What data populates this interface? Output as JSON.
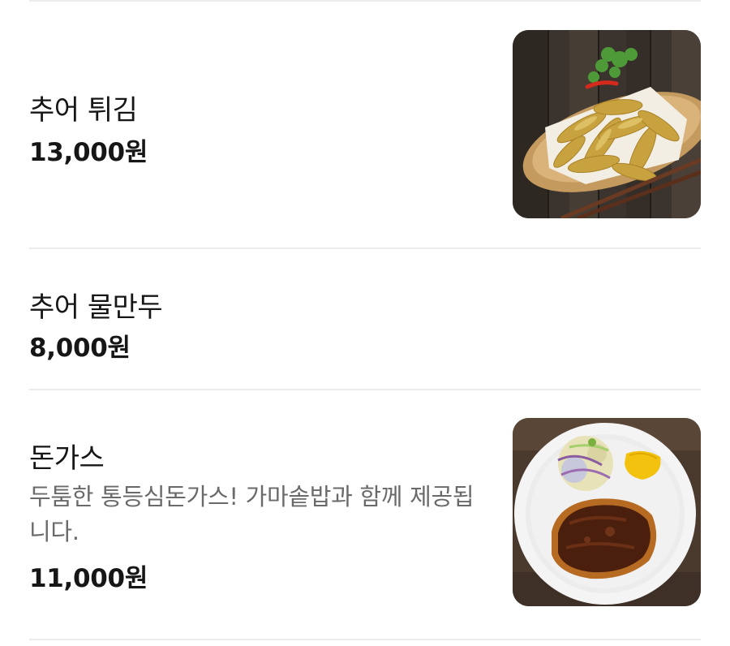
{
  "menu": {
    "items": [
      {
        "name": "추어 튀김",
        "price": "13,000원",
        "image_icon": "fried-loach-photo"
      },
      {
        "name": "추어 물만두",
        "price": "8,000원"
      },
      {
        "name": "돈가스",
        "description": "두툼한 통등심돈가스! 가마솥밥과 함께 제공됩니다.",
        "price": "11,000원",
        "image_icon": "pork-cutlet-photo"
      }
    ]
  },
  "colors": {
    "text_primary": "#161616",
    "text_secondary": "#6a6a6a",
    "divider": "#ececec",
    "background": "#ffffff"
  }
}
